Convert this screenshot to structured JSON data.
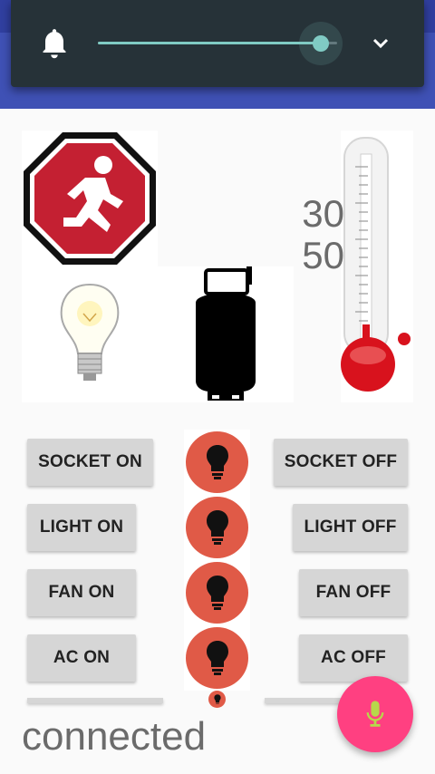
{
  "volume_panel": {
    "icon": "bell-icon",
    "level": 0.93,
    "expand_icon": "chevron-down-icon",
    "accent_color": "#80cbc4"
  },
  "sensors": {
    "temperature": "30",
    "humidity": "50"
  },
  "images": {
    "exit_sign": "exit-sign-icon",
    "light_bulb": "light-bulb-icon",
    "gas_cylinder": "gas-cylinder-icon",
    "thermometer": "thermometer-icon"
  },
  "controls": [
    {
      "device": "socket",
      "on_label": "SOCKET ON",
      "off_label": "SOCKET OFF"
    },
    {
      "device": "light",
      "on_label": "LIGHT ON",
      "off_label": "LIGHT OFF"
    },
    {
      "device": "fan",
      "on_label": "FAN ON",
      "off_label": "FAN OFF"
    },
    {
      "device": "ac",
      "on_label": "AC ON",
      "off_label": "AC OFF"
    }
  ],
  "status": {
    "text": "connected"
  },
  "fab": {
    "icon": "microphone-icon",
    "color": "#ff4081"
  },
  "colors": {
    "primary": "#3f51b5",
    "primary_dark": "#303f9f",
    "lamp_off": "#e05a47"
  }
}
